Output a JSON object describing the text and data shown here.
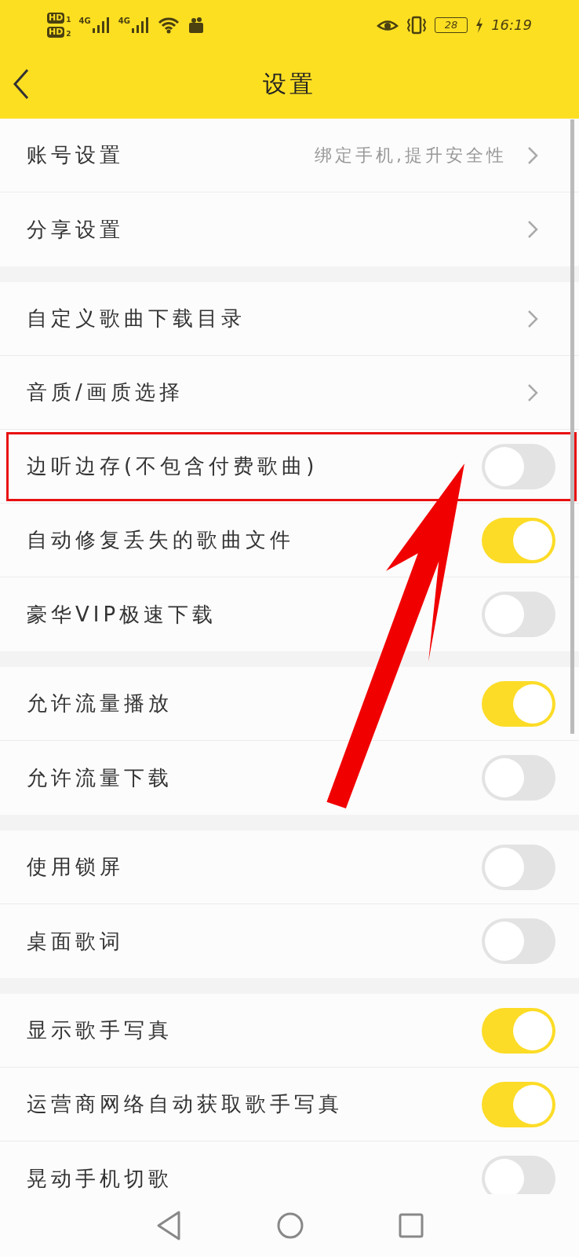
{
  "status_bar": {
    "sims": [
      {
        "label": "HD",
        "slot": "1"
      },
      {
        "label": "HD",
        "slot": "2"
      }
    ],
    "networks": [
      "4G",
      "4G"
    ],
    "battery": "28",
    "time": "16:19"
  },
  "header": {
    "title": "设置"
  },
  "sections": [
    {
      "rows": [
        {
          "kind": "link",
          "label": "账号设置",
          "hint": "绑定手机,提升安全性"
        },
        {
          "kind": "link",
          "label": "分享设置"
        }
      ]
    },
    {
      "rows": [
        {
          "kind": "link",
          "label": "自定义歌曲下载目录"
        },
        {
          "kind": "link",
          "label": "音质/画质选择"
        },
        {
          "kind": "toggle",
          "label": "边听边存(不包含付费歌曲)",
          "on": false,
          "framed": true
        },
        {
          "kind": "toggle",
          "label": "自动修复丢失的歌曲文件",
          "on": true
        },
        {
          "kind": "toggle",
          "label": "豪华VIP极速下载",
          "on": false
        }
      ]
    },
    {
      "rows": [
        {
          "kind": "toggle",
          "label": "允许流量播放",
          "on": true
        },
        {
          "kind": "toggle",
          "label": "允许流量下载",
          "on": false
        }
      ]
    },
    {
      "rows": [
        {
          "kind": "toggle",
          "label": "使用锁屏",
          "on": false
        },
        {
          "kind": "toggle",
          "label": "桌面歌词",
          "on": false
        }
      ]
    },
    {
      "rows": [
        {
          "kind": "toggle",
          "label": "显示歌手写真",
          "on": true
        },
        {
          "kind": "toggle",
          "label": "运营商网络自动获取歌手写真",
          "on": true
        },
        {
          "kind": "toggle",
          "label": "晃动手机切歌",
          "on": false
        }
      ]
    }
  ],
  "annotations": [
    {
      "kind": "arrow"
    }
  ]
}
